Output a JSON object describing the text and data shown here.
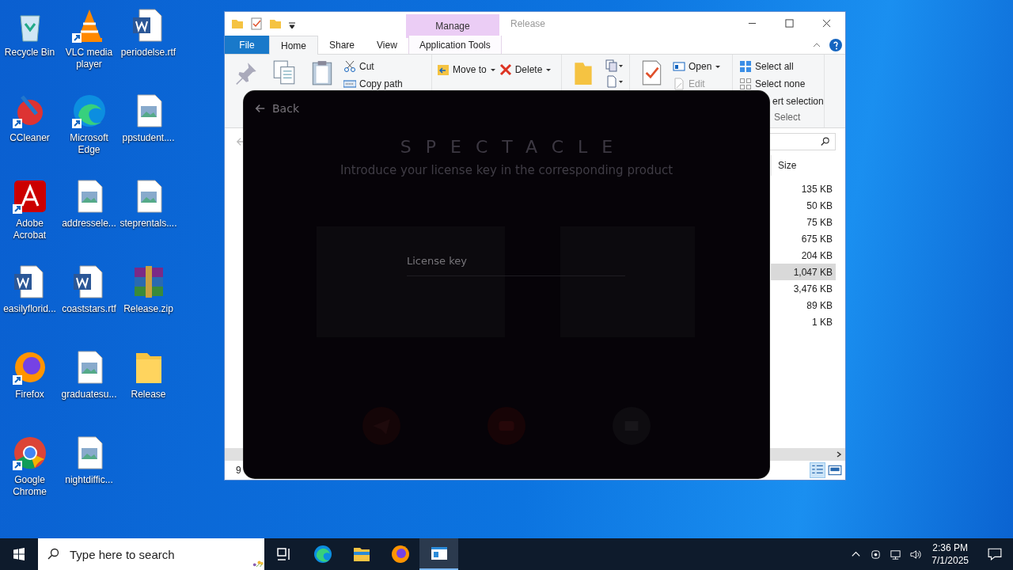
{
  "desktop": {
    "icons": [
      {
        "label": "Recycle Bin",
        "kind": "recycle",
        "shortcut": false
      },
      {
        "label": "CCleaner",
        "kind": "ccleaner",
        "shortcut": true
      },
      {
        "label": "Adobe Acrobat",
        "kind": "acrobat",
        "shortcut": true
      },
      {
        "label": "easilyflorid...",
        "kind": "word",
        "shortcut": false
      },
      {
        "label": "Firefox",
        "kind": "firefox",
        "shortcut": true
      },
      {
        "label": "Google Chrome",
        "kind": "chrome",
        "shortcut": true
      },
      {
        "label": "VLC media player",
        "kind": "vlc",
        "shortcut": true
      },
      {
        "label": "Microsoft Edge",
        "kind": "edge",
        "shortcut": true
      },
      {
        "label": "addressele...",
        "kind": "image",
        "shortcut": false
      },
      {
        "label": "coaststars.rtf",
        "kind": "word",
        "shortcut": false
      },
      {
        "label": "graduatesu...",
        "kind": "image",
        "shortcut": false
      },
      {
        "label": "nightdiffic...",
        "kind": "image",
        "shortcut": false
      },
      {
        "label": "periodelse.rtf",
        "kind": "word",
        "shortcut": false
      },
      {
        "label": "ppstudent....",
        "kind": "image",
        "shortcut": false
      },
      {
        "label": "steprentals....",
        "kind": "image",
        "shortcut": false
      },
      {
        "label": "Release.zip",
        "kind": "winrar",
        "shortcut": false
      },
      {
        "label": "Release",
        "kind": "folder",
        "shortcut": false
      }
    ]
  },
  "explorer": {
    "title": "Release",
    "context_group": "Manage",
    "tabs": [
      {
        "label": "File",
        "kind": "file",
        "selected": false
      },
      {
        "label": "Home",
        "kind": "tab",
        "selected": true
      },
      {
        "label": "Share",
        "kind": "tab",
        "selected": false
      },
      {
        "label": "View",
        "kind": "tab",
        "selected": false
      },
      {
        "label": "Application Tools",
        "kind": "context",
        "selected": false
      }
    ],
    "ribbon": {
      "cut": "Cut",
      "copy_path": "Copy path",
      "move_to": "Move to",
      "delete": "Delete",
      "open": "Open",
      "edit": "Edit",
      "select_all": "Select all",
      "select_none": "Select none",
      "invert_selection": "ert selection",
      "select_group": "Select"
    },
    "column": "Size",
    "rows": [
      {
        "size": "135 KB",
        "selected": false
      },
      {
        "size": "50 KB",
        "selected": false
      },
      {
        "size": "75 KB",
        "selected": false
      },
      {
        "size": "675 KB",
        "selected": false
      },
      {
        "size": "204 KB",
        "selected": false
      },
      {
        "size": "1,047 KB",
        "selected": true
      },
      {
        "size": "3,476 KB",
        "selected": false
      },
      {
        "size": "89 KB",
        "selected": false
      },
      {
        "size": "1 KB",
        "selected": false
      }
    ],
    "status": "9"
  },
  "dialog": {
    "back": "Back",
    "title": "SPECTACLE",
    "subtitle": "Introduce your license key in the corresponding product",
    "field_label": "License key"
  },
  "taskbar": {
    "search_placeholder": "Type here to search",
    "apps": [
      {
        "kind": "taskview",
        "selected": false
      },
      {
        "kind": "edge",
        "selected": false
      },
      {
        "kind": "explorer",
        "selected": false
      },
      {
        "kind": "firefox",
        "selected": false
      },
      {
        "kind": "window",
        "selected": true
      }
    ],
    "time": "2:36 PM",
    "date": "7/1/2025"
  }
}
